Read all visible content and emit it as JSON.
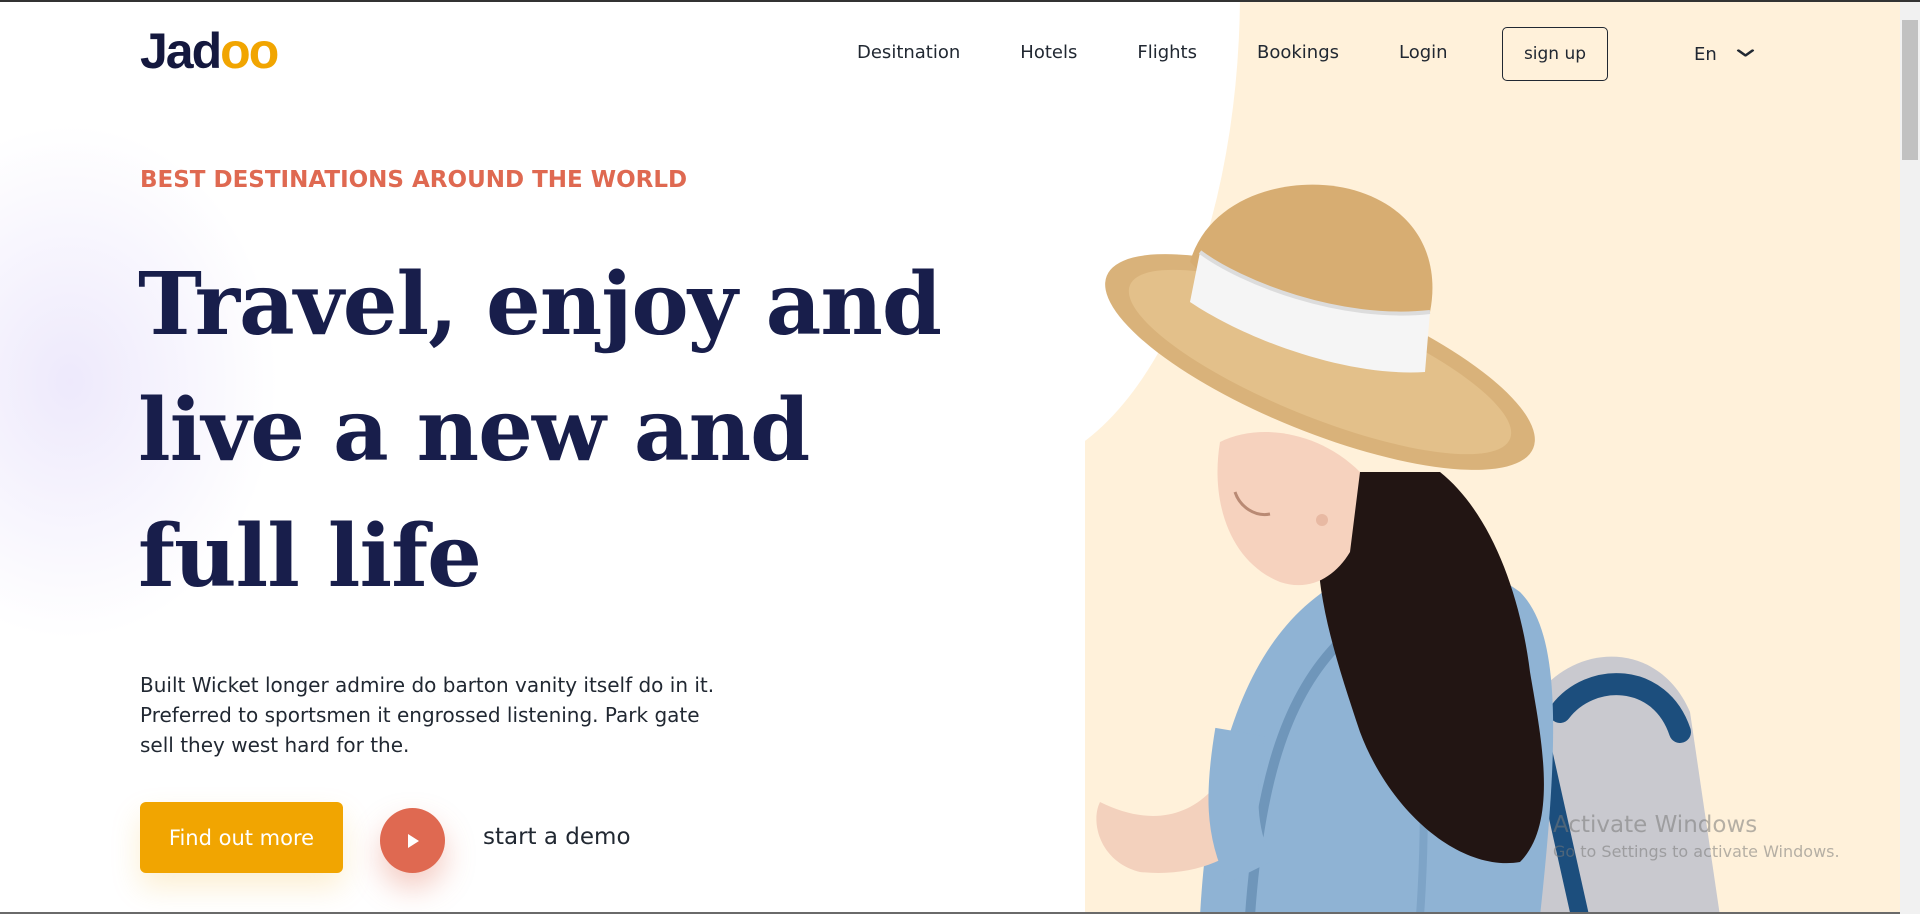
{
  "header": {
    "logo": {
      "base": "Jad",
      "o1": "o",
      "o2": "o"
    },
    "nav": [
      "Desitnation",
      "Hotels",
      "Flights",
      "Bookings",
      "Login"
    ],
    "signup_label": "sign up",
    "language": {
      "selected": "En",
      "icon": "chevron-down-icon"
    }
  },
  "hero": {
    "eyebrow": "BEST DESTINATIONS AROUND THE WORLD",
    "headline": [
      "Travel, enjoy and",
      "live a new and",
      "full life"
    ],
    "description": [
      "Built Wicket longer admire do barton vanity itself do in it.",
      "Preferred to sportsmen it engrossed listening. Park gate",
      "sell they west hard for the."
    ],
    "cta_label": "Find out more",
    "demo_label": "start a demo",
    "play_icon": "play-icon"
  },
  "watermark": {
    "title": "Activate Windows",
    "subtitle": "Go to Settings to activate Windows."
  },
  "colors": {
    "primary_navy": "#181e4b",
    "accent_orange": "#df6951",
    "accent_yellow": "#f1a501",
    "blob_cream": "#fff1da",
    "text_dark": "#212832"
  }
}
